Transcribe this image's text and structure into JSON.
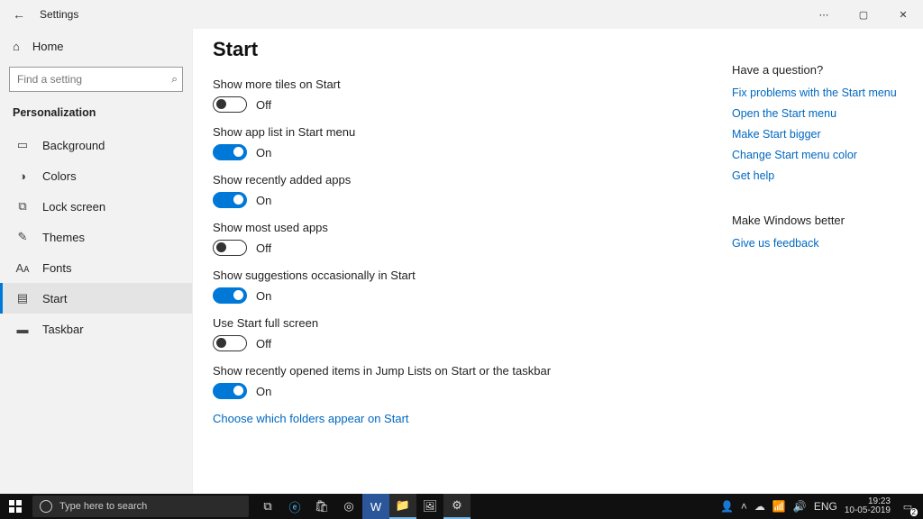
{
  "titlebar": {
    "title": "Settings"
  },
  "sidebar": {
    "home": "Home",
    "search_placeholder": "Find a setting",
    "section": "Personalization",
    "items": [
      {
        "icon": "▭",
        "label": "Background"
      },
      {
        "icon": "◑",
        "label": "Colors"
      },
      {
        "icon": "⧉",
        "label": "Lock screen"
      },
      {
        "icon": "✎",
        "label": "Themes"
      },
      {
        "icon": "Aᴀ",
        "label": "Fonts"
      },
      {
        "icon": "▤",
        "label": "Start"
      },
      {
        "icon": "▬",
        "label": "Taskbar"
      }
    ]
  },
  "main": {
    "heading": "Start",
    "settings": [
      {
        "label": "Show more tiles on Start",
        "on": false
      },
      {
        "label": "Show app list in Start menu",
        "on": true
      },
      {
        "label": "Show recently added apps",
        "on": true
      },
      {
        "label": "Show most used apps",
        "on": false
      },
      {
        "label": "Show suggestions occasionally in Start",
        "on": true
      },
      {
        "label": "Use Start full screen",
        "on": false
      },
      {
        "label": "Show recently opened items in Jump Lists on Start or the taskbar",
        "on": true
      }
    ],
    "state_on": "On",
    "state_off": "Off",
    "folder_link": "Choose which folders appear on Start"
  },
  "right": {
    "q_heading": "Have a question?",
    "q_links": [
      "Fix problems with the Start menu",
      "Open the Start menu",
      "Make Start bigger",
      "Change Start menu color",
      "Get help"
    ],
    "fb_heading": "Make Windows better",
    "fb_link": "Give us feedback"
  },
  "taskbar": {
    "search_placeholder": "Type here to search",
    "lang": "ENG",
    "time": "19:23",
    "date": "10-05-2019",
    "notif_count": "2"
  }
}
